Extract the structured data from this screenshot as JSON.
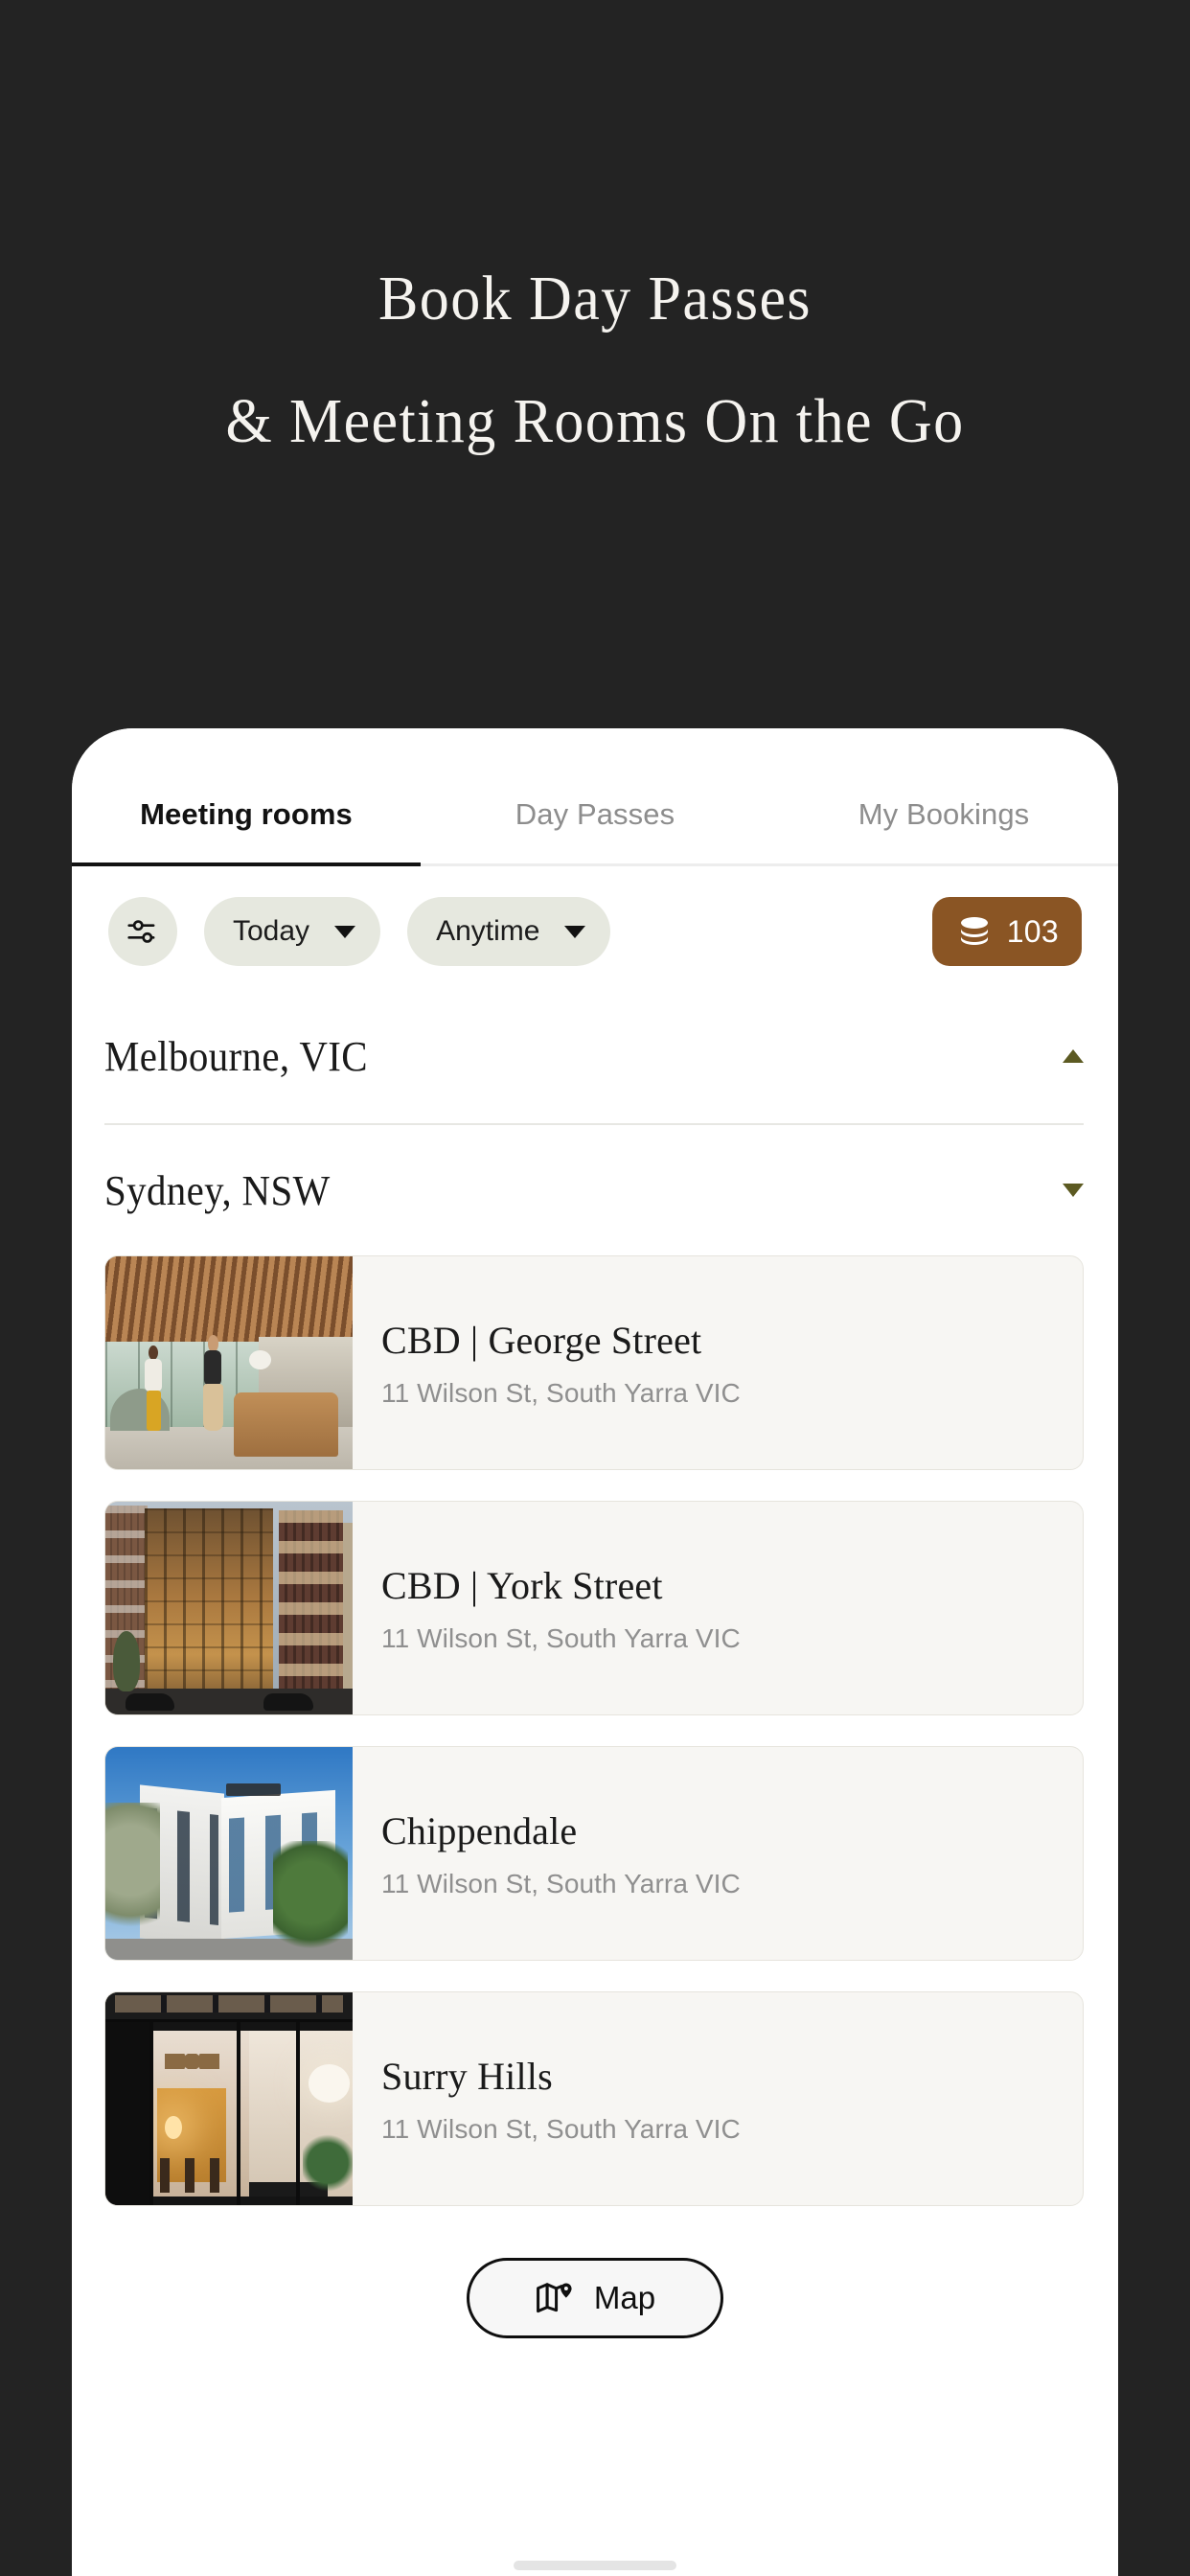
{
  "promo": {
    "headline_line1": "Book Day Passes",
    "headline_line2": "& Meeting Rooms On the Go",
    "background_color": "#232323",
    "text_color": "#F5F3EF"
  },
  "app": {
    "tabs": [
      {
        "label": "Meeting rooms",
        "active": true
      },
      {
        "label": "Day Passes",
        "active": false
      },
      {
        "label": "My Bookings",
        "active": false
      }
    ],
    "filters": {
      "filter_icon_name": "sliders-icon",
      "date_chip": {
        "label": "Today",
        "caret": "chevron-down-icon"
      },
      "time_chip": {
        "label": "Anytime",
        "caret": "chevron-down-icon"
      },
      "credits": {
        "value": "103",
        "icon_name": "coins-stack-icon",
        "color": "#8A5524"
      }
    },
    "cities": [
      {
        "name": "Melbourne, VIC",
        "expanded": false,
        "caret": "chevron-up-icon"
      },
      {
        "name": "Sydney, NSW",
        "expanded": true,
        "caret": "chevron-down-icon"
      }
    ],
    "locations": [
      {
        "title": "CBD | George Street",
        "address": "11 Wilson St, South Yarra VIC",
        "image_name": "coworking-lobby-photo"
      },
      {
        "title": "CBD | York Street",
        "address": "11 Wilson St, South Yarra VIC",
        "image_name": "bronze-glass-building-photo"
      },
      {
        "title": "Chippendale",
        "address": "11 Wilson St, South Yarra VIC",
        "image_name": "white-corner-building-photo"
      },
      {
        "title": "Surry Hills",
        "address": "11 Wilson St, South Yarra VIC",
        "image_name": "night-storefront-photo"
      }
    ],
    "map_button": {
      "label": "Map",
      "icon_name": "map-pin-icon"
    }
  }
}
